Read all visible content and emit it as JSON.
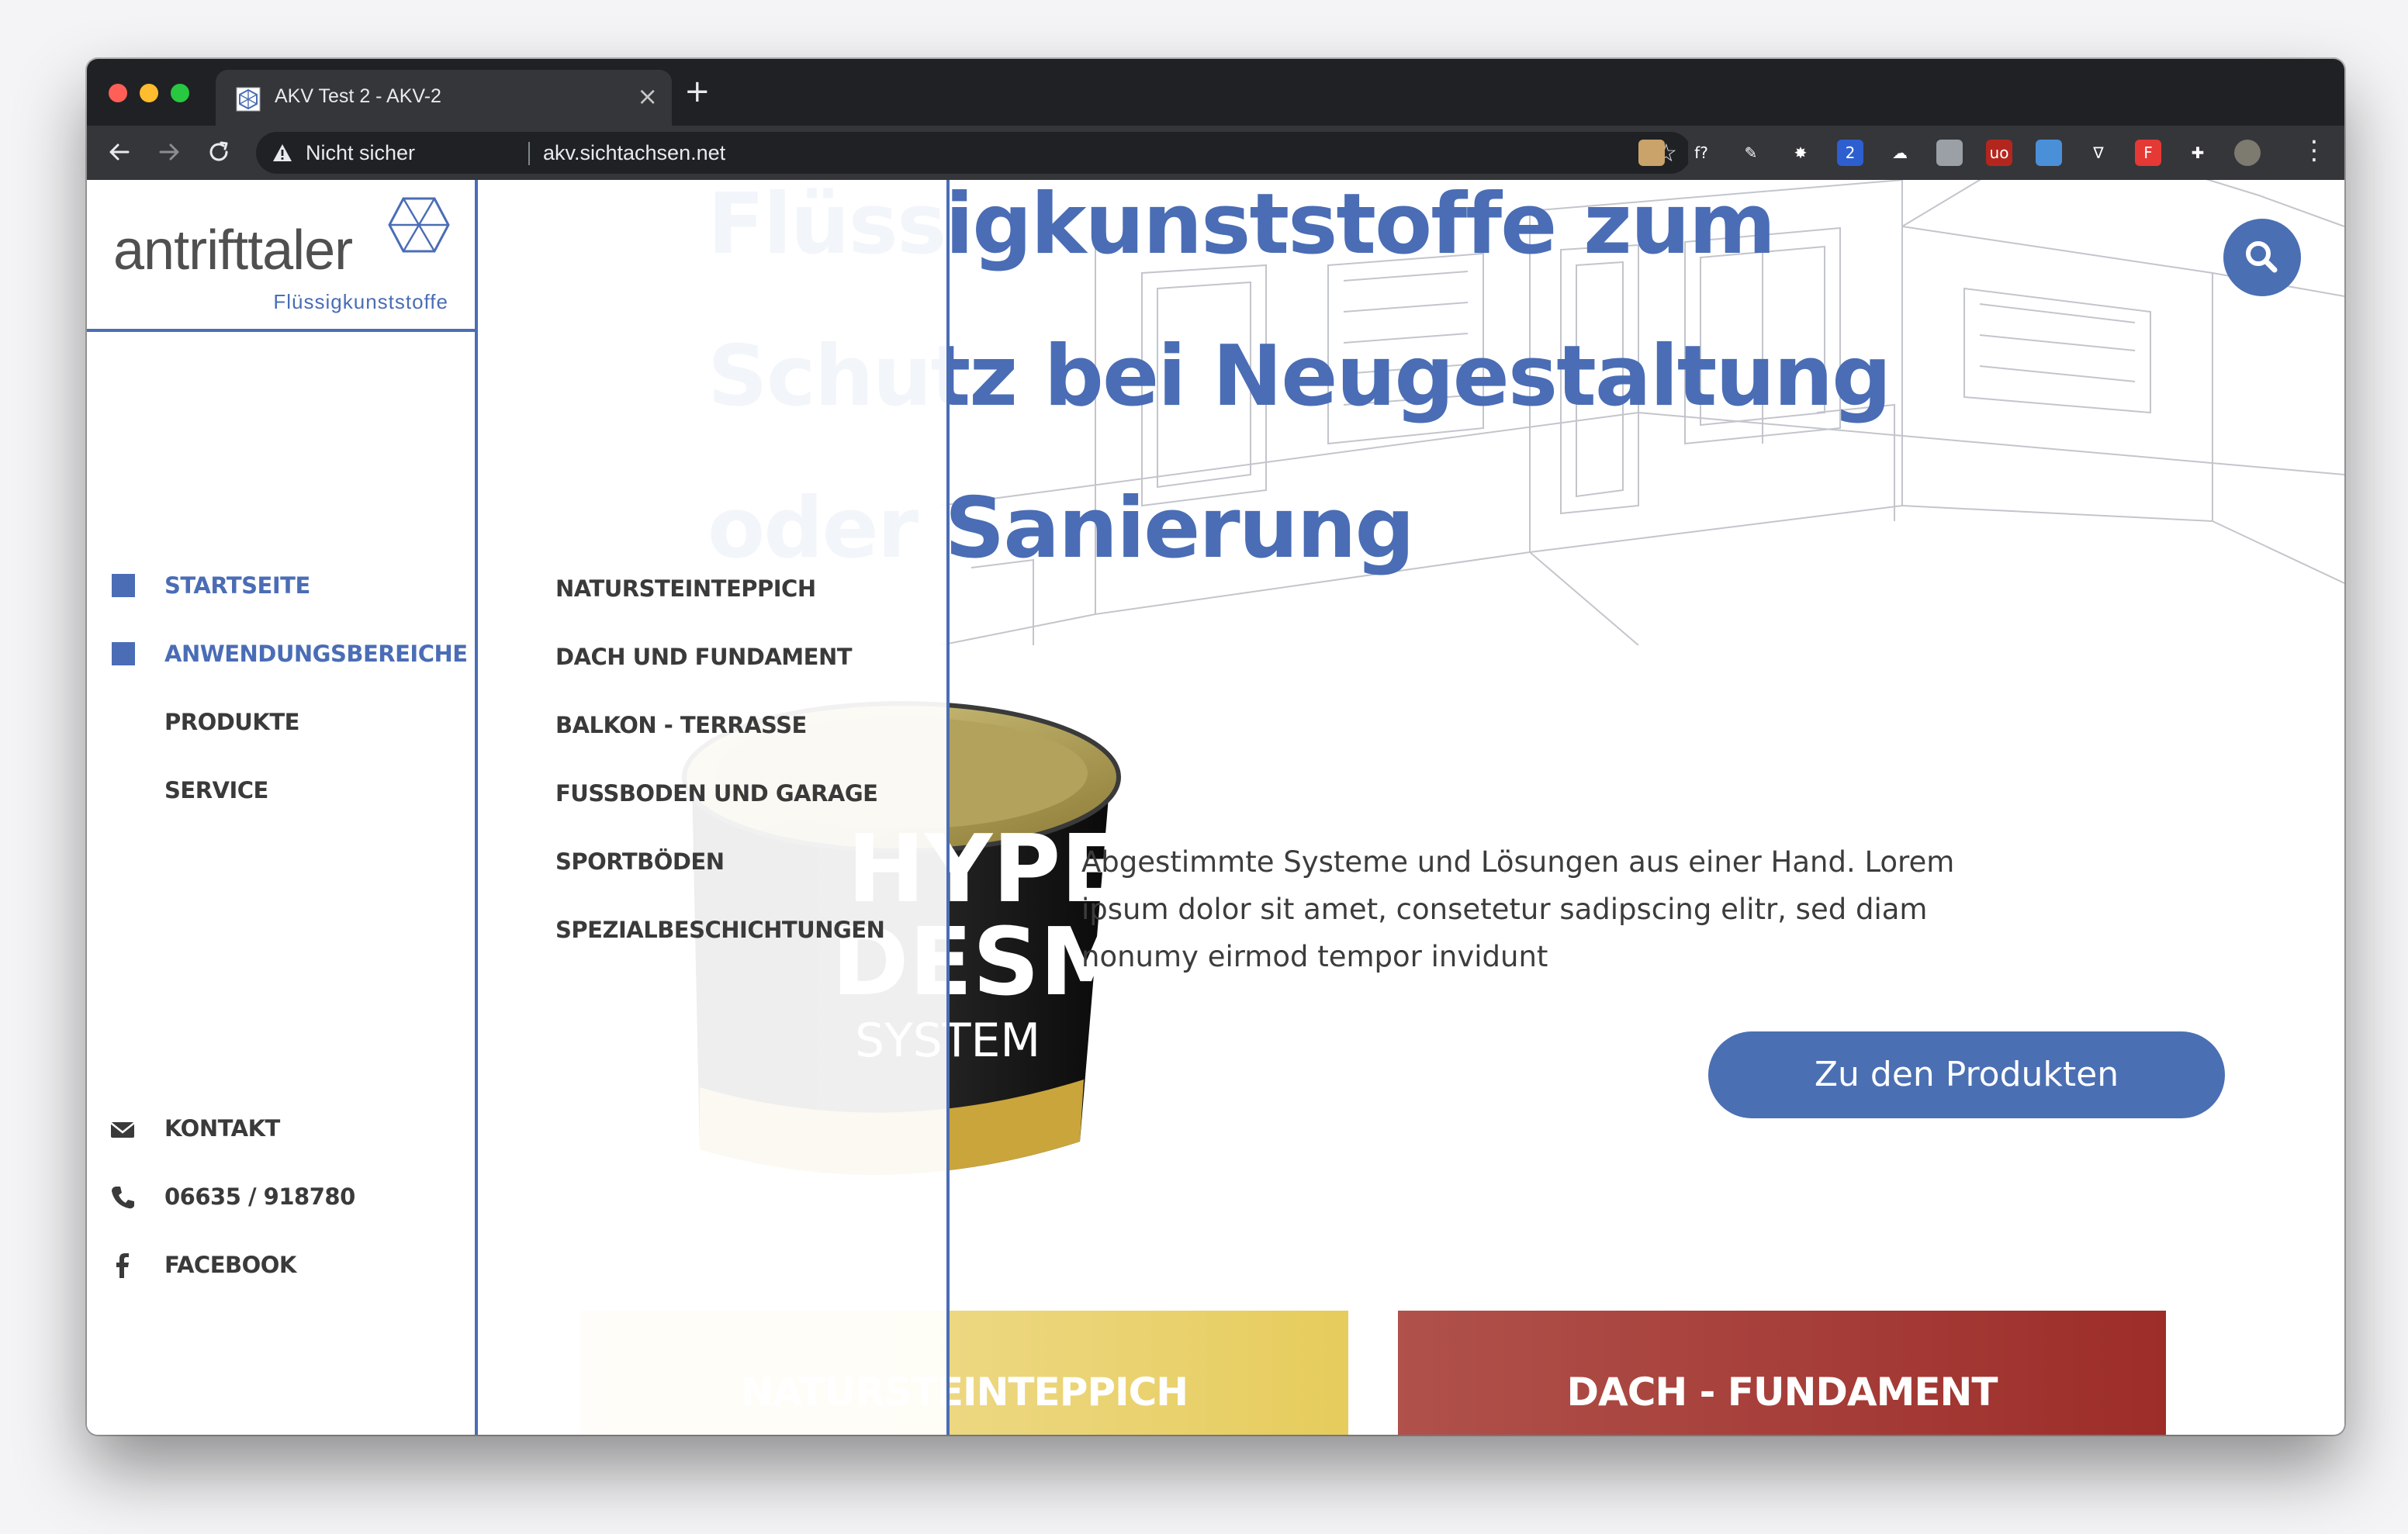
{
  "browser": {
    "tab_title": "AKV Test 2 - AKV-2",
    "tab_close": "×",
    "new_tab": "+",
    "security_label": "Nicht sicher",
    "url": "akv.sichtachsen.net",
    "extensions": [
      {
        "name": "extension-icon-1",
        "color": "#c9a36a",
        "glyph": ""
      },
      {
        "name": "extension-icon-2",
        "color": "#35363a",
        "glyph": "f?"
      },
      {
        "name": "extension-icon-3",
        "color": "#35363a",
        "glyph": "✎"
      },
      {
        "name": "extension-icon-4",
        "color": "#35363a",
        "glyph": "✸"
      },
      {
        "name": "extension-icon-5",
        "color": "#2d5fd0",
        "glyph": "2"
      },
      {
        "name": "extension-icon-6",
        "color": "#35363a",
        "glyph": "☁"
      },
      {
        "name": "extension-icon-7",
        "color": "#9aa0a6",
        "glyph": ""
      },
      {
        "name": "extension-icon-8",
        "color": "#b3261e",
        "glyph": "uo"
      },
      {
        "name": "extension-icon-9",
        "color": "#4a90d9",
        "glyph": ""
      },
      {
        "name": "extension-icon-10",
        "color": "#35363a",
        "glyph": "∇"
      },
      {
        "name": "extension-icon-11",
        "color": "#e53935",
        "glyph": "F"
      },
      {
        "name": "extensions-puzzle-icon",
        "color": "#35363a",
        "glyph": "✚"
      },
      {
        "name": "profile-avatar",
        "color": "#7d7a6f",
        "glyph": ""
      }
    ]
  },
  "site": {
    "logo_text": "antrifttaler",
    "logo_subtitle": "Flüssigkunststoffe",
    "nav": [
      {
        "label": "STARTSEITE",
        "active": true
      },
      {
        "label": "ANWENDUNGSBEREICHE",
        "active": true
      },
      {
        "label": "PRODUKTE",
        "active": false
      },
      {
        "label": "SERVICE",
        "active": false
      }
    ],
    "submenu": [
      "NATURSTEINTEPPICH",
      "DACH UND FUNDAMENT",
      "BALKON - TERRASSE",
      "FUSSBODEN UND GARAGE",
      "SPORTBÖDEN",
      "SPEZIALBESCHICHTUNGEN"
    ],
    "contact": {
      "kontakt": "KONTAKT",
      "phone": "06635 / 918780",
      "facebook": "FACEBOOK"
    },
    "hero": {
      "line1": "Flüssigkunststoffe zum",
      "line2": "Schutz bei Neugestaltung",
      "line3": "oder Sanierung",
      "tagline": "Abgestimmte Systeme und Lösungen aus einer Hand. Lorem ipsum dolor sit amet, consetetur sadipscing elitr, sed diam nonumy eirmod tempor invidunt",
      "cta": "Zu den Produkten"
    },
    "product_label": {
      "line1": "HYPER",
      "line2": "DESMO",
      "line3": "SYSTEM"
    },
    "cards": [
      "NATURSTEINTEPPICH",
      "DACH - FUNDAMENT"
    ],
    "colors": {
      "brand_blue": "#4a6db5",
      "card_yellow": "#e6cc5c",
      "card_red": "#9d2d29"
    }
  }
}
